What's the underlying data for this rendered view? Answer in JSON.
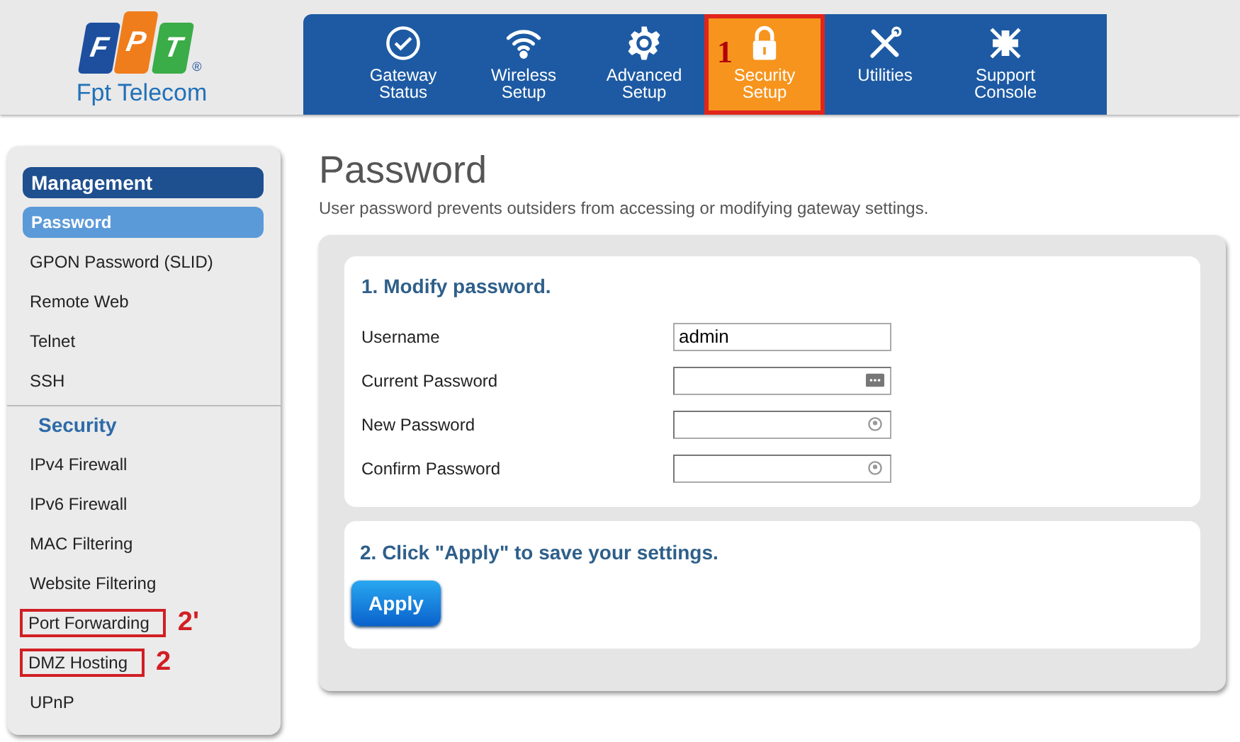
{
  "logo": {
    "letters": [
      "F",
      "P",
      "T"
    ],
    "mark": "®",
    "name": "Fpt Telecom"
  },
  "nav": [
    {
      "label": "Gateway\nStatus",
      "selected": false,
      "highlighted": false
    },
    {
      "label": "Wireless\nSetup",
      "selected": false,
      "highlighted": false
    },
    {
      "label": "Advanced\nSetup",
      "selected": false,
      "highlighted": false
    },
    {
      "label": "Security\nSetup",
      "selected": true,
      "highlighted": true,
      "annotation": "1"
    },
    {
      "label": "Utilities",
      "selected": false,
      "highlighted": false
    },
    {
      "label": "Support\nConsole",
      "selected": false,
      "highlighted": false
    }
  ],
  "sidebar": {
    "items": [
      {
        "kind": "header",
        "label": "Management",
        "selected": true
      },
      {
        "kind": "link",
        "label": "Password",
        "selected": true,
        "highlighted": false
      },
      {
        "kind": "link",
        "label": "GPON Password (SLID)",
        "selected": false,
        "highlighted": false
      },
      {
        "kind": "link",
        "label": "Remote Web",
        "selected": false,
        "highlighted": false
      },
      {
        "kind": "link",
        "label": "Telnet",
        "selected": false,
        "highlighted": false
      },
      {
        "kind": "link",
        "label": "SSH",
        "selected": false,
        "highlighted": false
      },
      {
        "kind": "header",
        "label": "Security",
        "selected": false
      },
      {
        "kind": "link",
        "label": "IPv4 Firewall",
        "selected": false,
        "highlighted": false
      },
      {
        "kind": "link",
        "label": "IPv6 Firewall",
        "selected": false,
        "highlighted": false
      },
      {
        "kind": "link",
        "label": "MAC Filtering",
        "selected": false,
        "highlighted": false
      },
      {
        "kind": "link",
        "label": "Website Filtering",
        "selected": false,
        "highlighted": false
      },
      {
        "kind": "link",
        "label": "Port Forwarding",
        "selected": false,
        "highlighted": true,
        "annotation": "2'"
      },
      {
        "kind": "link",
        "label": "DMZ Hosting",
        "selected": false,
        "highlighted": true,
        "annotation": "2"
      },
      {
        "kind": "link",
        "label": "UPnP",
        "selected": false,
        "highlighted": false
      }
    ]
  },
  "page": {
    "title": "Password",
    "description": "User password prevents outsiders from accessing or modifying gateway settings."
  },
  "step1": {
    "heading": "1. Modify password.",
    "fields": [
      {
        "label": "Username",
        "value": "admin",
        "kind": "text"
      },
      {
        "label": "Current Password",
        "kind": "password_dots"
      },
      {
        "label": "New Password",
        "kind": "password_key"
      },
      {
        "label": "Confirm Password",
        "kind": "password_key"
      }
    ]
  },
  "step2": {
    "heading": "2. Click \"Apply\" to save your settings.",
    "button": "Apply"
  }
}
